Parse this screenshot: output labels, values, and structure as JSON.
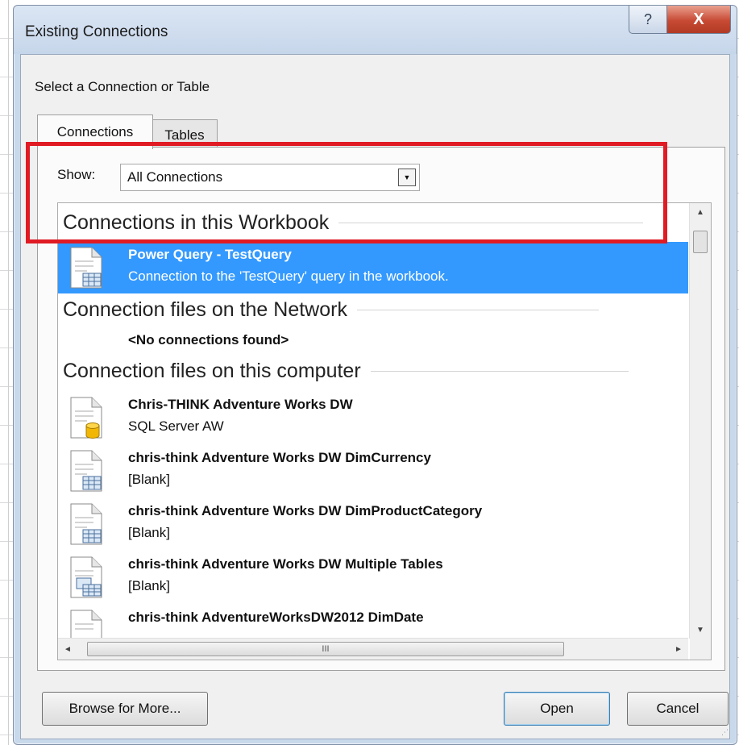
{
  "window": {
    "title": "Existing Connections",
    "help_glyph": "?",
    "close_glyph": "X"
  },
  "prompt": "Select a Connection or Table",
  "tabs": [
    {
      "label": "Connections",
      "selected": true
    },
    {
      "label": "Tables",
      "selected": false
    }
  ],
  "show": {
    "label": "Show:",
    "value": "All Connections",
    "arrow_glyph": "▼"
  },
  "groups": {
    "workbook": "Connections in this Workbook",
    "network": "Connection files on the Network",
    "computer": "Connection files on this computer"
  },
  "workbook_items": [
    {
      "name": "Power Query - TestQuery",
      "description": "Connection to the 'TestQuery' query in the workbook.",
      "icon": "table-connection-icon",
      "selected": true
    }
  ],
  "network_empty": "<No connections found>",
  "computer_items": [
    {
      "name": "Chris-THINK Adventure Works DW",
      "description": "SQL Server AW",
      "icon": "database-connection-icon"
    },
    {
      "name": "chris-think Adventure Works DW DimCurrency",
      "description": "[Blank]",
      "icon": "table-connection-icon"
    },
    {
      "name": "chris-think Adventure Works DW DimProductCategory",
      "description": "[Blank]",
      "icon": "table-connection-icon"
    },
    {
      "name": "chris-think Adventure Works DW Multiple Tables",
      "description": "[Blank]",
      "icon": "multiple-tables-connection-icon"
    },
    {
      "name": "chris-think AdventureWorksDW2012 DimDate",
      "description": "",
      "icon": "table-connection-icon"
    }
  ],
  "scroll": {
    "up_glyph": "▲",
    "down_glyph": "▼",
    "left_glyph": "◄",
    "right_glyph": "►",
    "h_thumb_grip": "III"
  },
  "buttons": {
    "browse": "Browse for More...",
    "open": "Open",
    "cancel": "Cancel"
  },
  "colors": {
    "selection": "#3399ff",
    "highlight_box": "#e01b24",
    "close_button": "#c74a34"
  }
}
